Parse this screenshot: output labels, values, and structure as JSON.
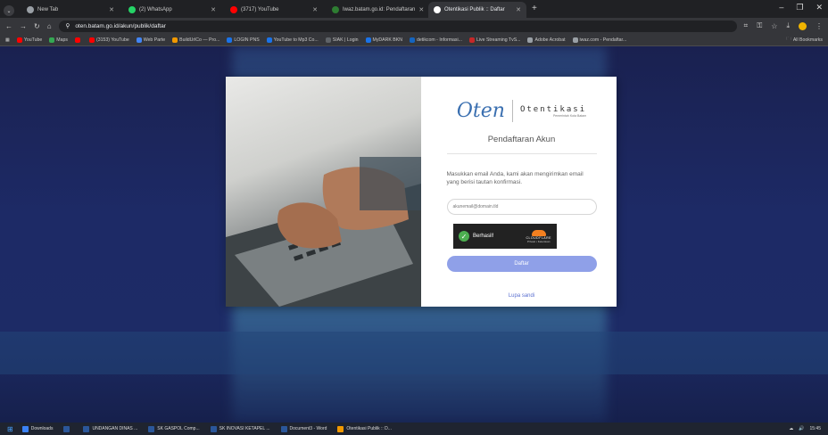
{
  "browser": {
    "tabs": [
      {
        "label": "New Tab",
        "color": "#9aa0a6"
      },
      {
        "label": "(2) WhatsApp",
        "color": "#25d366"
      },
      {
        "label": "(3717) YouTube",
        "color": "#ff0000"
      },
      {
        "label": "Iwaz.batam.go.id: Pendaftaran",
        "color": "#2e7d32"
      },
      {
        "label": "Otentikasi Publik :: Daftar",
        "color": "#ffffff"
      }
    ],
    "new_tab": "+",
    "url": "oten.batam.go.id/akun/publik/daftar",
    "bookmarks": [
      {
        "label": "YouTube",
        "color": "#ff0000"
      },
      {
        "label": "Maps",
        "color": "#34a853"
      },
      {
        "label": "",
        "color": "#ff0000"
      },
      {
        "label": "(3153) YouTube",
        "color": "#ff0000"
      },
      {
        "label": "Web Parte",
        "color": "#4285f4"
      },
      {
        "label": "BuildUrlCo — Pro...",
        "color": "#f29900"
      },
      {
        "label": "LOGIN PNS",
        "color": "#1a73e8"
      },
      {
        "label": "YouTube to Mp3 Co...",
        "color": "#1a73e8"
      },
      {
        "label": "SIAK | Login",
        "color": "#5f6368"
      },
      {
        "label": "MyDARK BKN",
        "color": "#1a73e8"
      },
      {
        "label": "detikcom - Informasi...",
        "color": "#1565c0"
      },
      {
        "label": "Live Streaming TvS...",
        "color": "#c62828"
      },
      {
        "label": "Adobe Acrobat",
        "color": "#9aa0a6"
      },
      {
        "label": "iwaz.com - Pendaftar...",
        "color": "#9aa0a6"
      }
    ],
    "all_bookmarks": "All Bookmarks"
  },
  "form": {
    "logo_mark": "Oten",
    "logo_name": "Otentikasi",
    "logo_sub": "Pemerintah Kota Batam",
    "title": "Pendaftaran Akun",
    "description": "Masukkan email Anda, kami akan mengirimkan email yang berisi tautan konfirmasi.",
    "email_value": "akunemail@domain.tld",
    "captcha_status": "Berhasil!",
    "captcha_brand": "CLOUDFLARE",
    "captcha_links": "Privasi • Ketentuan",
    "submit_label": "Daftar",
    "back_link": "Lupa sandi"
  },
  "taskbar": {
    "items": [
      {
        "label": "Downloads",
        "color": "#3b82f6"
      },
      {
        "label": "",
        "color": "#2b579a"
      },
      {
        "label": "UNDANGAN DINAS ...",
        "color": "#2b579a"
      },
      {
        "label": "SK GASPOL Comp...",
        "color": "#2b579a"
      },
      {
        "label": "SK INOVASI KETAPEL ...",
        "color": "#2b579a"
      },
      {
        "label": "Document3 - Word",
        "color": "#2b579a"
      },
      {
        "label": "Otentikasi Publik :: D...",
        "color": "#f29900"
      }
    ],
    "time": "15:45"
  }
}
